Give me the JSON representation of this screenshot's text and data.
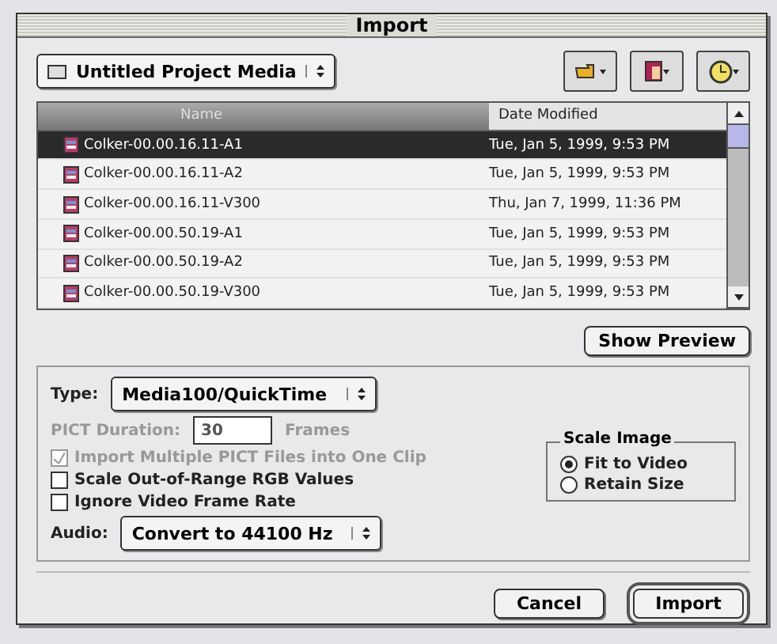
{
  "window": {
    "title": "Import"
  },
  "folder_popup": {
    "label": "Untitled Project Media"
  },
  "toolbar": [
    {
      "kind": "pointer"
    },
    {
      "kind": "document"
    },
    {
      "kind": "clock"
    }
  ],
  "file_list": {
    "columns": [
      "Name",
      "Date Modified"
    ],
    "rows": [
      {
        "name": "Colker-00.00.16.11-A1",
        "date": "Tue, Jan 5, 1999, 9:53 PM",
        "selected": true
      },
      {
        "name": "Colker-00.00.16.11-A2",
        "date": "Tue, Jan 5, 1999, 9:53 PM",
        "selected": false
      },
      {
        "name": "Colker-00.00.16.11-V300",
        "date": "Thu, Jan 7, 1999, 11:36 PM",
        "selected": false
      },
      {
        "name": "Colker-00.00.50.19-A1",
        "date": "Tue, Jan 5, 1999, 9:53 PM",
        "selected": false
      },
      {
        "name": "Colker-00.00.50.19-A2",
        "date": "Tue, Jan 5, 1999, 9:53 PM",
        "selected": false
      },
      {
        "name": "Colker-00.00.50.19-V300",
        "date": "Tue, Jan 5, 1999, 9:53 PM",
        "selected": false
      }
    ]
  },
  "show_preview_button": "Show Preview",
  "options": {
    "type": {
      "label": "Type:",
      "value": "Media100/QuickTime"
    },
    "pict_duration": {
      "label": "PICT Duration:",
      "value": "30",
      "unit": "Frames",
      "disabled": true
    },
    "checkboxes": [
      {
        "label": "Import Multiple PICT Files into One Clip",
        "checked": true,
        "disabled": true
      },
      {
        "label": "Scale Out-of-Range RGB Values",
        "checked": false,
        "disabled": false
      },
      {
        "label": "Ignore Video Frame Rate",
        "checked": false,
        "disabled": false
      }
    ],
    "audio": {
      "label": "Audio:",
      "value": "Convert to 44100 Hz"
    },
    "scale_image": {
      "title": "Scale Image",
      "options": [
        {
          "label": "Fit to Video",
          "selected": true
        },
        {
          "label": "Retain Size",
          "selected": false
        }
      ]
    }
  },
  "buttons": [
    {
      "label": "Cancel",
      "default": false
    },
    {
      "label": "Import",
      "default": true
    }
  ]
}
